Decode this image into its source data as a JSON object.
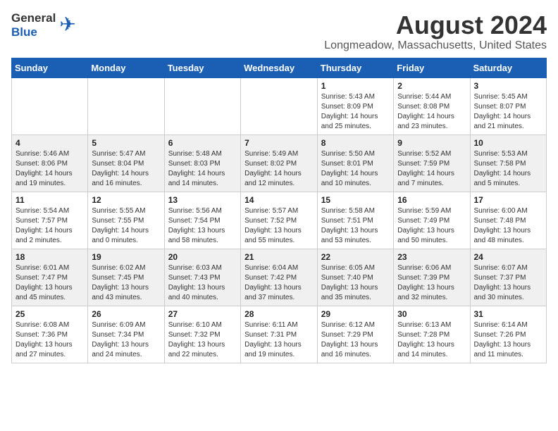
{
  "header": {
    "logo_general": "General",
    "logo_blue": "Blue",
    "month_year": "August 2024",
    "location": "Longmeadow, Massachusetts, United States"
  },
  "weekdays": [
    "Sunday",
    "Monday",
    "Tuesday",
    "Wednesday",
    "Thursday",
    "Friday",
    "Saturday"
  ],
  "weeks": [
    [
      {
        "day": "",
        "info": ""
      },
      {
        "day": "",
        "info": ""
      },
      {
        "day": "",
        "info": ""
      },
      {
        "day": "",
        "info": ""
      },
      {
        "day": "1",
        "info": "Sunrise: 5:43 AM\nSunset: 8:09 PM\nDaylight: 14 hours\nand 25 minutes."
      },
      {
        "day": "2",
        "info": "Sunrise: 5:44 AM\nSunset: 8:08 PM\nDaylight: 14 hours\nand 23 minutes."
      },
      {
        "day": "3",
        "info": "Sunrise: 5:45 AM\nSunset: 8:07 PM\nDaylight: 14 hours\nand 21 minutes."
      }
    ],
    [
      {
        "day": "4",
        "info": "Sunrise: 5:46 AM\nSunset: 8:06 PM\nDaylight: 14 hours\nand 19 minutes."
      },
      {
        "day": "5",
        "info": "Sunrise: 5:47 AM\nSunset: 8:04 PM\nDaylight: 14 hours\nand 16 minutes."
      },
      {
        "day": "6",
        "info": "Sunrise: 5:48 AM\nSunset: 8:03 PM\nDaylight: 14 hours\nand 14 minutes."
      },
      {
        "day": "7",
        "info": "Sunrise: 5:49 AM\nSunset: 8:02 PM\nDaylight: 14 hours\nand 12 minutes."
      },
      {
        "day": "8",
        "info": "Sunrise: 5:50 AM\nSunset: 8:01 PM\nDaylight: 14 hours\nand 10 minutes."
      },
      {
        "day": "9",
        "info": "Sunrise: 5:52 AM\nSunset: 7:59 PM\nDaylight: 14 hours\nand 7 minutes."
      },
      {
        "day": "10",
        "info": "Sunrise: 5:53 AM\nSunset: 7:58 PM\nDaylight: 14 hours\nand 5 minutes."
      }
    ],
    [
      {
        "day": "11",
        "info": "Sunrise: 5:54 AM\nSunset: 7:57 PM\nDaylight: 14 hours\nand 2 minutes."
      },
      {
        "day": "12",
        "info": "Sunrise: 5:55 AM\nSunset: 7:55 PM\nDaylight: 14 hours\nand 0 minutes."
      },
      {
        "day": "13",
        "info": "Sunrise: 5:56 AM\nSunset: 7:54 PM\nDaylight: 13 hours\nand 58 minutes."
      },
      {
        "day": "14",
        "info": "Sunrise: 5:57 AM\nSunset: 7:52 PM\nDaylight: 13 hours\nand 55 minutes."
      },
      {
        "day": "15",
        "info": "Sunrise: 5:58 AM\nSunset: 7:51 PM\nDaylight: 13 hours\nand 53 minutes."
      },
      {
        "day": "16",
        "info": "Sunrise: 5:59 AM\nSunset: 7:49 PM\nDaylight: 13 hours\nand 50 minutes."
      },
      {
        "day": "17",
        "info": "Sunrise: 6:00 AM\nSunset: 7:48 PM\nDaylight: 13 hours\nand 48 minutes."
      }
    ],
    [
      {
        "day": "18",
        "info": "Sunrise: 6:01 AM\nSunset: 7:47 PM\nDaylight: 13 hours\nand 45 minutes."
      },
      {
        "day": "19",
        "info": "Sunrise: 6:02 AM\nSunset: 7:45 PM\nDaylight: 13 hours\nand 43 minutes."
      },
      {
        "day": "20",
        "info": "Sunrise: 6:03 AM\nSunset: 7:43 PM\nDaylight: 13 hours\nand 40 minutes."
      },
      {
        "day": "21",
        "info": "Sunrise: 6:04 AM\nSunset: 7:42 PM\nDaylight: 13 hours\nand 37 minutes."
      },
      {
        "day": "22",
        "info": "Sunrise: 6:05 AM\nSunset: 7:40 PM\nDaylight: 13 hours\nand 35 minutes."
      },
      {
        "day": "23",
        "info": "Sunrise: 6:06 AM\nSunset: 7:39 PM\nDaylight: 13 hours\nand 32 minutes."
      },
      {
        "day": "24",
        "info": "Sunrise: 6:07 AM\nSunset: 7:37 PM\nDaylight: 13 hours\nand 30 minutes."
      }
    ],
    [
      {
        "day": "25",
        "info": "Sunrise: 6:08 AM\nSunset: 7:36 PM\nDaylight: 13 hours\nand 27 minutes."
      },
      {
        "day": "26",
        "info": "Sunrise: 6:09 AM\nSunset: 7:34 PM\nDaylight: 13 hours\nand 24 minutes."
      },
      {
        "day": "27",
        "info": "Sunrise: 6:10 AM\nSunset: 7:32 PM\nDaylight: 13 hours\nand 22 minutes."
      },
      {
        "day": "28",
        "info": "Sunrise: 6:11 AM\nSunset: 7:31 PM\nDaylight: 13 hours\nand 19 minutes."
      },
      {
        "day": "29",
        "info": "Sunrise: 6:12 AM\nSunset: 7:29 PM\nDaylight: 13 hours\nand 16 minutes."
      },
      {
        "day": "30",
        "info": "Sunrise: 6:13 AM\nSunset: 7:28 PM\nDaylight: 13 hours\nand 14 minutes."
      },
      {
        "day": "31",
        "info": "Sunrise: 6:14 AM\nSunset: 7:26 PM\nDaylight: 13 hours\nand 11 minutes."
      }
    ]
  ]
}
